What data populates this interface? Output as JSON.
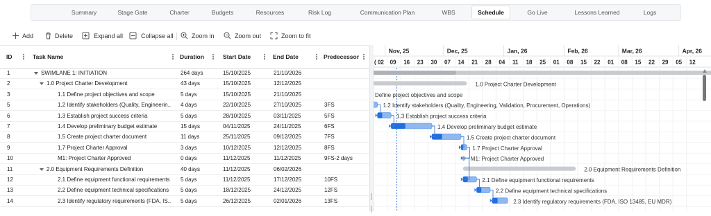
{
  "nav": {
    "tabs": [
      {
        "label": "Summary",
        "active": false
      },
      {
        "label": "Stage Gate",
        "active": false
      },
      {
        "label": "Charter",
        "active": false
      },
      {
        "label": "Budgets",
        "active": false
      },
      {
        "label": "Resources",
        "active": false
      },
      {
        "label": "Risk Log",
        "active": false
      },
      {
        "label": "Communication Plan",
        "active": false
      },
      {
        "label": "WBS",
        "active": false
      },
      {
        "label": "Schedule",
        "active": true
      },
      {
        "label": "Go Live",
        "active": false
      },
      {
        "label": "Lessons Learned",
        "active": false
      },
      {
        "label": "Logs",
        "active": false
      }
    ]
  },
  "toolbar": {
    "add": "Add",
    "delete": "Delete",
    "expand_all": "Expand all",
    "collapse_all": "Collapse all",
    "zoom_in": "Zoom in",
    "zoom_out": "Zoom out",
    "zoom_fit": "Zoom to fit"
  },
  "columns": {
    "id": "ID",
    "task": "Task Name",
    "duration": "Duration",
    "start": "Start Date",
    "end": "End Date",
    "pred": "Predecessor"
  },
  "rows": [
    {
      "id": "1",
      "name": "SWIMLANE 1: INITIATION",
      "level": 0,
      "caret": true,
      "duration": "264 days",
      "start": "15/10/2025",
      "end": "21/10/2026",
      "pred": ""
    },
    {
      "id": "2",
      "name": "1.0 Project Charter Development",
      "level": 1,
      "caret": true,
      "duration": "43 days",
      "start": "15/10/2025",
      "end": "12/12/2025",
      "pred": ""
    },
    {
      "id": "3",
      "name": "1.1 Define project objectives and scope",
      "level": 2,
      "caret": false,
      "duration": "5 days",
      "start": "15/10/2025",
      "end": "21/10/2025",
      "pred": ""
    },
    {
      "id": "5",
      "name": "1.2 Identify stakeholders (Quality, Engineerin...",
      "level": 2,
      "caret": false,
      "duration": "4 days",
      "start": "22/10/2025",
      "end": "27/10/2025",
      "pred": "3FS"
    },
    {
      "id": "6",
      "name": "1.3 Establish project success criteria",
      "level": 2,
      "caret": false,
      "duration": "5 days",
      "start": "28/10/2025",
      "end": "03/11/2025",
      "pred": "5FS"
    },
    {
      "id": "7",
      "name": "1.4 Develop preliminary budget estimate",
      "level": 2,
      "caret": false,
      "duration": "15 days",
      "start": "04/11/2025",
      "end": "24/11/2025",
      "pred": "6FS"
    },
    {
      "id": "8",
      "name": "1.5 Create project charter document",
      "level": 2,
      "caret": false,
      "duration": "11 days",
      "start": "25/11/2025",
      "end": "09/12/2025",
      "pred": "7FS"
    },
    {
      "id": "9",
      "name": "1.7 Project Charter Approval",
      "level": 2,
      "caret": false,
      "duration": "3 days",
      "start": "10/12/2025",
      "end": "12/12/2025",
      "pred": "8FS"
    },
    {
      "id": "10",
      "name": "M1: Project Charter Approved",
      "level": 2,
      "caret": false,
      "duration": "0 days",
      "start": "11/12/2025",
      "end": "11/12/2025",
      "pred": "9FS-2 days"
    },
    {
      "id": "11",
      "name": "2.0 Equipment Requirements Definition",
      "level": 1,
      "caret": true,
      "duration": "40 days",
      "start": "11/12/2025",
      "end": "06/02/2026",
      "pred": ""
    },
    {
      "id": "12",
      "name": "2.1 Define equipment functional requirements",
      "level": 2,
      "caret": false,
      "duration": "5 days",
      "start": "11/12/2025",
      "end": "17/12/2025",
      "pred": "10FS"
    },
    {
      "id": "13",
      "name": "2.2 Define equipment technical specifications",
      "level": 2,
      "caret": false,
      "duration": "5 days",
      "start": "18/12/2025",
      "end": "24/12/2025",
      "pred": "12FS"
    },
    {
      "id": "14",
      "name": "2.3 Identify regulatory requirements (FDA, IS...",
      "level": 2,
      "caret": false,
      "duration": "5 days",
      "start": "26/12/2025",
      "end": "02/01/2026",
      "pred": "13FS"
    }
  ],
  "timeline": {
    "months": [
      "Nov, 25",
      "Dec, 25",
      "Jan, 26",
      "Feb, 26",
      "Mar, 26",
      "Apr, 26"
    ],
    "days": [
      "( 02",
      "09",
      "16",
      "23",
      "30",
      "07",
      "14",
      "21",
      "28",
      "04",
      "11",
      "18",
      "25",
      "01",
      "08",
      "15",
      "22",
      "01",
      "08",
      "15",
      "22",
      "29",
      "05",
      "12"
    ]
  },
  "bars": [
    {
      "label": "",
      "kind": "summary",
      "start": "2025-10-15",
      "end": "2026-10-21"
    },
    {
      "label": "1.0 Project Charter Development",
      "kind": "summary",
      "start": "2025-10-15",
      "end": "2025-12-12"
    },
    {
      "label": "Define project objectives and scope",
      "kind": "task",
      "start": "2025-10-15",
      "end": "2025-10-21"
    },
    {
      "label": "1.2 Identify stakeholders (Quality, Engineering, Validation, Procurement, Operations)",
      "kind": "task",
      "start": "2025-10-22",
      "end": "2025-10-27"
    },
    {
      "label": "1.3 Establish project success criteria",
      "kind": "task",
      "start": "2025-10-28",
      "end": "2025-11-03"
    },
    {
      "label": "1.4 Develop preliminary budget estimate",
      "kind": "task",
      "start": "2025-11-04",
      "end": "2025-11-24"
    },
    {
      "label": "1.5 Create project charter document",
      "kind": "task",
      "start": "2025-11-25",
      "end": "2025-12-09"
    },
    {
      "label": "1.7 Project Charter Approval",
      "kind": "task",
      "start": "2025-12-10",
      "end": "2025-12-12"
    },
    {
      "label": "M1: Project Charter Approved",
      "kind": "milestone",
      "start": "2025-12-11",
      "end": "2025-12-11"
    },
    {
      "label": "2.0 Equipment Requirements Definition",
      "kind": "summary",
      "start": "2025-12-11",
      "end": "2026-02-06"
    },
    {
      "label": "2.1 Define equipment functional requirements",
      "kind": "task",
      "start": "2025-12-11",
      "end": "2025-12-17"
    },
    {
      "label": "2.2 Define equipment technical specifications",
      "kind": "task",
      "start": "2025-12-18",
      "end": "2025-12-24"
    },
    {
      "label": "2.3 Identify regulatory requirements (FDA, ISO 13485, EU MDR)",
      "kind": "task",
      "start": "2025-12-26",
      "end": "2026-01-02"
    }
  ],
  "today_marker_date": "2025-11-07",
  "colors": {
    "task_bar": "#8fb8f0",
    "task_bar_border": "#4d8fe6",
    "task_progress": "#1f6fe0",
    "summary_bar": "#c8cbcf",
    "milestone": "#aab0b8",
    "dependency": "#3a7be0",
    "today": "#2f6fd6"
  }
}
